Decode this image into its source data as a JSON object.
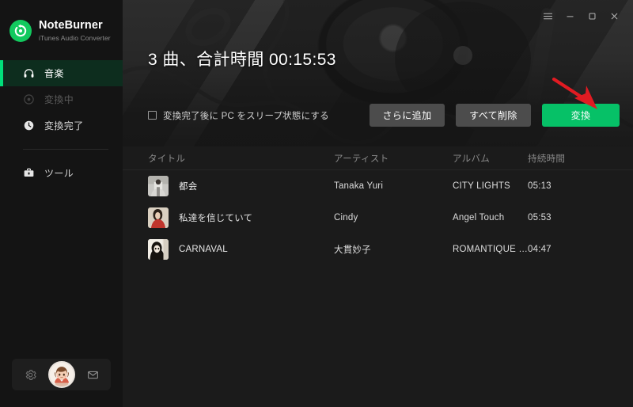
{
  "app": {
    "brand_name": "NoteBurner",
    "brand_subtitle": "iTunes Audio Converter",
    "accent_green": "#06c167",
    "accent_bar": "#00e07a",
    "background": "#1b1b1b",
    "sidebar_background": "#141414"
  },
  "window_controls": {
    "menu": "menu-icon",
    "minimize": "minimize-icon",
    "maximize": "maximize-icon",
    "close": "close-icon"
  },
  "sidebar": {
    "items": [
      {
        "label": "音楽",
        "icon": "headphones-icon",
        "active": true,
        "dimmed": false
      },
      {
        "label": "変換中",
        "icon": "converting-circle-icon",
        "active": false,
        "dimmed": true
      },
      {
        "label": "変換完了",
        "icon": "clock-icon",
        "active": false,
        "dimmed": false
      },
      {
        "label": "ツール",
        "icon": "toolbox-icon",
        "active": false,
        "dimmed": false
      }
    ],
    "bottom": {
      "settings_icon": "gear-icon",
      "avatar_icon": "user-avatar",
      "mail_icon": "envelope-icon"
    }
  },
  "hero": {
    "title": "3 曲、合計時間 00:15:53",
    "sleep_checkbox_label": "変換完了後に PC をスリープ状態にする",
    "sleep_checked": false,
    "buttons": {
      "add_more": "さらに追加",
      "delete_all": "すべて削除",
      "convert": "変換"
    },
    "annotation": {
      "type": "red-arrow",
      "color": "#e11b22",
      "points_to": "convert-button"
    }
  },
  "table": {
    "columns": [
      "タイトル",
      "アーティスト",
      "アルバム",
      "持続時間"
    ],
    "rows": [
      {
        "title": "都会",
        "artist": "Tanaka Yuri",
        "album": "CITY LIGHTS",
        "duration": "05:13",
        "cover": "cover-city-lights"
      },
      {
        "title": "私達を信じていて",
        "artist": "Cindy",
        "album": "Angel Touch",
        "duration": "05:53",
        "cover": "cover-angel-touch"
      },
      {
        "title": "CARNAVAL",
        "artist": "大貫妙子",
        "album": "ROMANTIQUE (M...",
        "duration": "04:47",
        "cover": "cover-romantique"
      }
    ]
  }
}
